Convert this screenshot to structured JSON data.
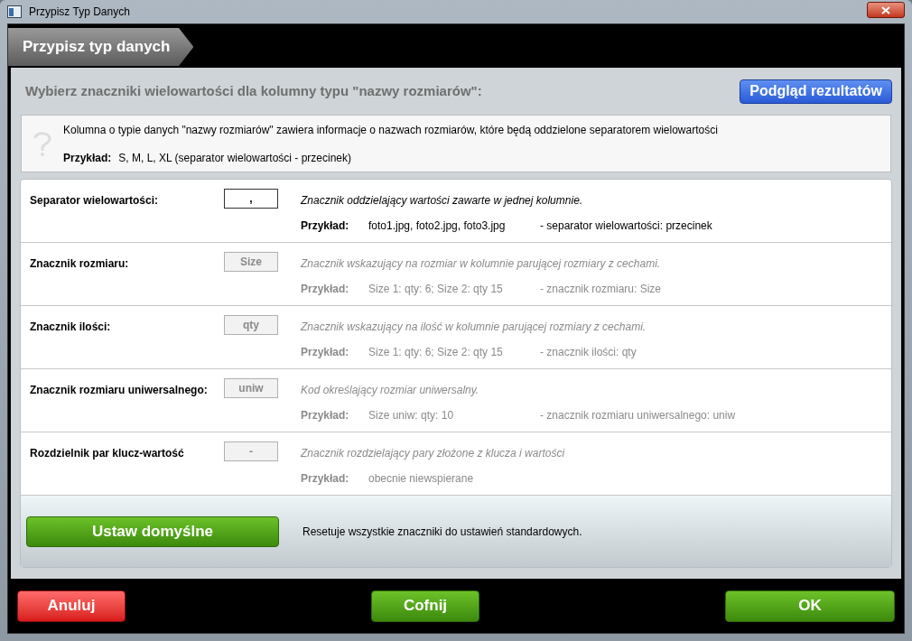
{
  "window": {
    "title": "Przypisz Typ Danych"
  },
  "header": {
    "title": "Przypisz typ danych"
  },
  "heading": "Wybierz znaczniki wielowartości dla kolumny typu \"nazwy rozmiarów\":",
  "preview_button": "Podgląd rezultatów",
  "info": {
    "text": "Kolumna o typie danych \"nazwy rozmiarów\" zawiera informacje o nazwach rozmiarów, które będą oddzielone separatorem wielowartości",
    "example_label": "Przykład:",
    "example": "S, M, L, XL (separator wielowartości - przecinek)"
  },
  "rows": [
    {
      "label": "Separator wielowartości:",
      "value": ",",
      "disabled": false,
      "description": "Znacznik oddzielający wartości zawarte w jednej kolumnie.",
      "example_label": "Przykład:",
      "example": "foto1.jpg, foto2.jpg, foto3.jpg",
      "note": "- separator wielowartości: przecinek"
    },
    {
      "label": "Znacznik rozmiaru:",
      "value": "Size",
      "disabled": true,
      "description": "Znacznik wskazujący na rozmiar w kolumnie parującej rozmiary z cechami.",
      "example_label": "Przykład:",
      "example": "Size 1: qty: 6; Size 2: qty 15",
      "note": "- znacznik rozmiaru: Size"
    },
    {
      "label": "Znacznik ilości:",
      "value": "qty",
      "disabled": true,
      "description": "Znacznik wskazujący na ilość w kolumnie parującej rozmiary z cechami.",
      "example_label": "Przykład:",
      "example": "Size 1: qty: 6; Size 2: qty 15",
      "note": "- znacznik ilości: qty"
    },
    {
      "label": "Znacznik rozmiaru uniwersalnego:",
      "value": "uniw",
      "disabled": true,
      "description": "Kod określający rozmiar uniwersalny.",
      "example_label": "Przykład:",
      "example": "Size uniw: qty: 10",
      "note": "- znacznik rozmiaru uniwersalnego: uniw"
    },
    {
      "label": "Rozdzielnik par klucz-wartość",
      "value": "-",
      "disabled": true,
      "description": "Znacznik rozdzielający pary złożone z klucza i wartości",
      "example_label": "Przykład:",
      "example": "obecnie niewspierane"
    }
  ],
  "reset": {
    "button": "Ustaw domyślne",
    "text": "Resetuje wszystkie znaczniki do ustawień standardowych."
  },
  "footer_buttons": [
    {
      "label": "Anuluj",
      "kind": "cancel"
    },
    {
      "label": "Cofnij",
      "kind": "back"
    },
    {
      "label": "OK",
      "kind": "ok"
    }
  ]
}
